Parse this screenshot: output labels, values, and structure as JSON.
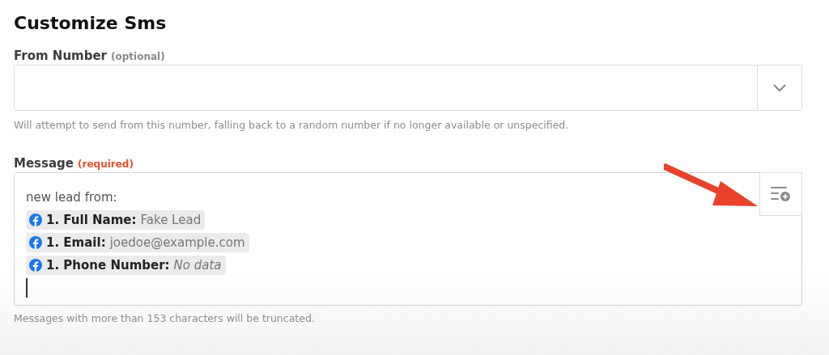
{
  "title": "Customize Sms",
  "from_number": {
    "label": "From Number",
    "tag": "(optional)",
    "required": false,
    "hint": "Will attempt to send from this number, falling back to a random number if no longer available or unspecified."
  },
  "message": {
    "label": "Message",
    "tag": "(required)",
    "required": true,
    "lines": [
      {
        "kind": "text",
        "text": "new lead from:"
      },
      {
        "kind": "field",
        "label": "1. Full Name:",
        "value": "Fake Lead",
        "has_data": true
      },
      {
        "kind": "field",
        "label": "1. Email:",
        "value": "joedoe@example.com",
        "has_data": true
      },
      {
        "kind": "field",
        "label": "1. Phone Number:",
        "value": "No data",
        "has_data": false
      }
    ],
    "hint": "Messages with more than 153 characters will be truncated."
  }
}
